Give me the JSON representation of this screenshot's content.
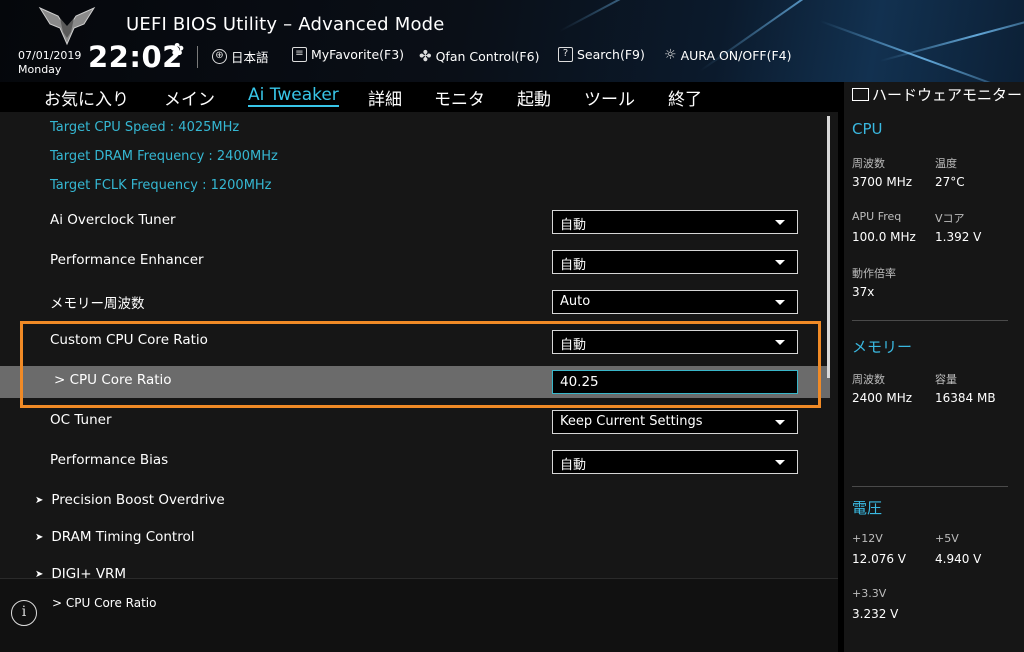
{
  "header": {
    "title": "UEFI BIOS Utility – Advanced Mode",
    "date": "07/01/2019",
    "day": "Monday",
    "time": "22:02",
    "tools": {
      "language": "日本語",
      "myfavorite": "MyFavorite(F3)",
      "qfan": "Qfan Control(F6)",
      "search": "Search(F9)",
      "aura": "AURA ON/OFF(F4)"
    }
  },
  "menu": {
    "items": [
      "お気に入り",
      "メイン",
      "Ai Tweaker",
      "詳細",
      "モニタ",
      "起動",
      "ツール",
      "終了"
    ],
    "active": "Ai Tweaker"
  },
  "main": {
    "info": [
      "Target CPU Speed : 4025MHz",
      "Target DRAM Frequency : 2400MHz",
      "Target FCLK Frequency : 1200MHz"
    ],
    "settings": [
      {
        "label": "Ai Overclock Tuner",
        "value": "自動"
      },
      {
        "label": "Performance Enhancer",
        "value": "自動"
      },
      {
        "label": "メモリー周波数",
        "value": "Auto"
      },
      {
        "label": "Custom CPU Core Ratio",
        "value": "自動"
      },
      {
        "label": "> CPU Core Ratio",
        "value": "40.25"
      },
      {
        "label": "OC Tuner",
        "value": "Keep Current Settings"
      },
      {
        "label": "Performance Bias",
        "value": "自動"
      }
    ],
    "submenus": [
      "Precision Boost Overdrive",
      "DRAM Timing Control",
      "DIGI+ VRM"
    ]
  },
  "help": {
    "text": "> CPU Core Ratio"
  },
  "monitor": {
    "title": "ハードウェアモニター",
    "cpu": {
      "section": "CPU",
      "freq_label": "周波数",
      "freq": "3700 MHz",
      "temp_label": "温度",
      "temp": "27°C",
      "apu_label": "APU Freq",
      "apu": "100.0 MHz",
      "vcore_label": "Vコア",
      "vcore": "1.392 V",
      "ratio_label": "動作倍率",
      "ratio": "37x"
    },
    "memory": {
      "section": "メモリー",
      "freq_label": "周波数",
      "freq": "2400 MHz",
      "cap_label": "容量",
      "cap": "16384 MB"
    },
    "voltage": {
      "section": "電圧",
      "v12_label": "+12V",
      "v12": "12.076 V",
      "v5_label": "+5V",
      "v5": "4.940 V",
      "v33_label": "+3.3V",
      "v33": "3.232 V"
    }
  }
}
